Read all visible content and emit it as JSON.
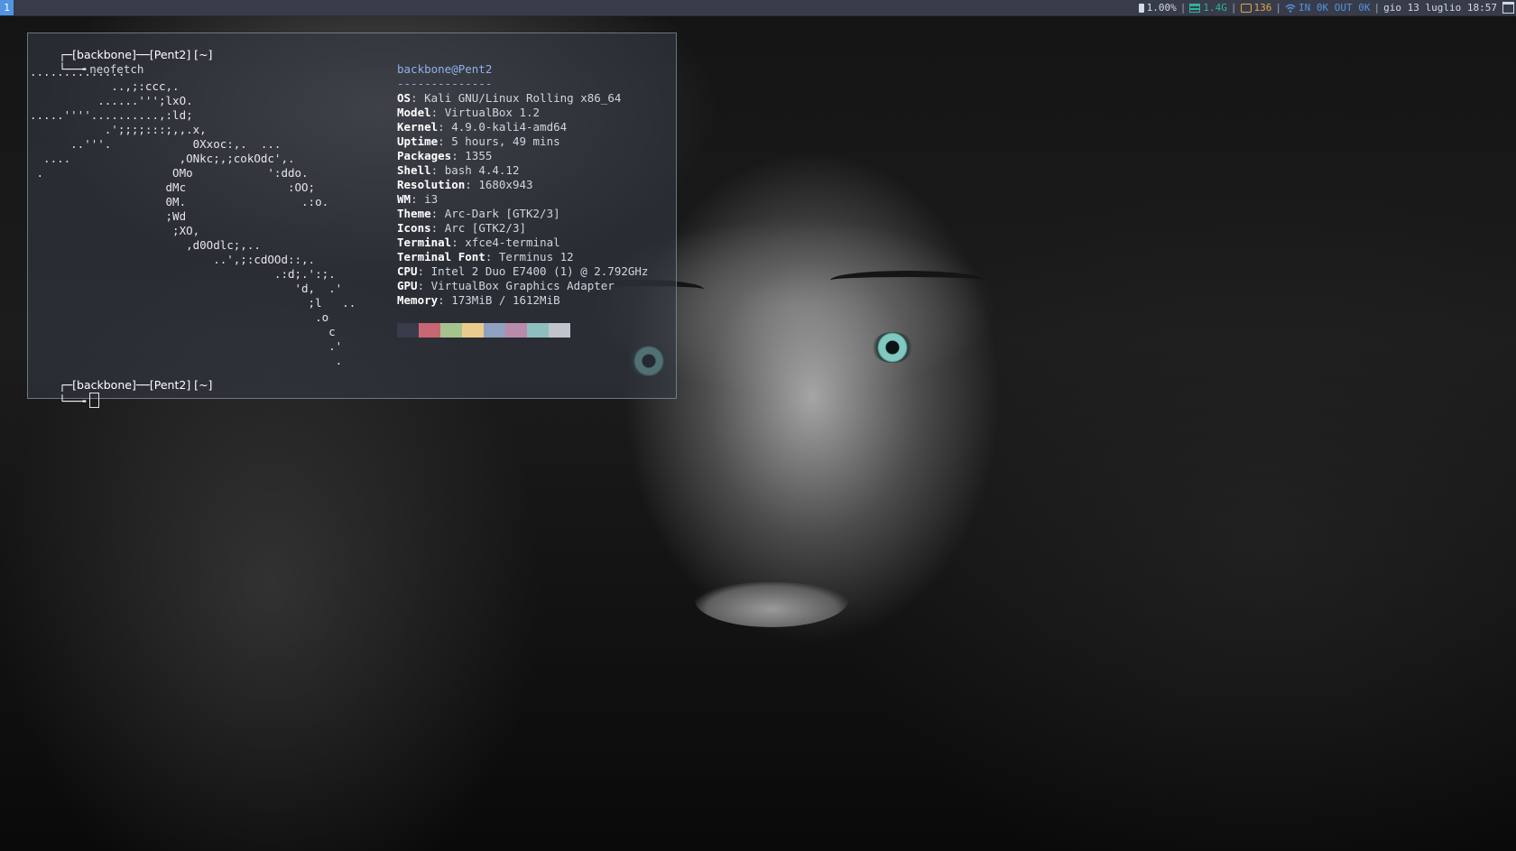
{
  "topbar": {
    "workspace": "1",
    "battery": "1.00%",
    "memory": "1.4G",
    "disk": "136",
    "network": "IN 0K OUT 0K",
    "datetime": "gio 13 luglio 18:57",
    "colors": {
      "bar_bg": "#383c4a",
      "workspace_bg": "#5294e2",
      "memory": "#2eb398",
      "disk": "#e2a544",
      "network": "#5294e2"
    }
  },
  "terminal": {
    "prompt1": {
      "user": "backbone",
      "host": "Pent2",
      "dir": "~",
      "command": "neofetch"
    },
    "prompt2": {
      "user": "backbone",
      "host": "Pent2",
      "dir": "~"
    },
    "ascii_art": "..............\n            ..,;:ccc,.\n          ......''';lxO.\n.....''''..........,:ld;\n           .';;;;:::;,,.x,\n      ..'''.            0Xxoc:,.  ...\n  ....                ,ONkc;,;cokOdc',.\n .                   OMo           ':ddo.\n                    dMc               :OO;\n                    0M.                 .:o.\n                    ;Wd\n                     ;XO,\n                       ,d0Odlc;,..\n                           ..',;:cdOOd::,.\n                                    .:d;.':;.\n                                       'd,  .'\n                                         ;l   ..\n                                          .o\n                                            c\n                                            .'\n                                             .",
    "info": {
      "title": "backbone@Pent2",
      "underline": "--------------",
      "rows": [
        {
          "key": "OS",
          "value": "Kali GNU/Linux Rolling x86_64"
        },
        {
          "key": "Model",
          "value": "VirtualBox 1.2"
        },
        {
          "key": "Kernel",
          "value": "4.9.0-kali4-amd64"
        },
        {
          "key": "Uptime",
          "value": "5 hours, 49 mins"
        },
        {
          "key": "Packages",
          "value": "1355"
        },
        {
          "key": "Shell",
          "value": "bash 4.4.12"
        },
        {
          "key": "Resolution",
          "value": "1680x943"
        },
        {
          "key": "WM",
          "value": "i3"
        },
        {
          "key": "Theme",
          "value": "Arc-Dark [GTK2/3]"
        },
        {
          "key": "Icons",
          "value": "Arc [GTK2/3]"
        },
        {
          "key": "Terminal",
          "value": "xfce4-terminal"
        },
        {
          "key": "Terminal Font",
          "value": "Terminus 12"
        },
        {
          "key": "CPU",
          "value": "Intel 2 Duo E7400 (1) @ 2.792GHz"
        },
        {
          "key": "GPU",
          "value": "VirtualBox Graphics Adapter"
        },
        {
          "key": "Memory",
          "value": "173MiB / 1612MiB"
        }
      ],
      "palette": [
        "#383c4a",
        "#c86772",
        "#a5c38d",
        "#e9cb8c",
        "#8ea1c1",
        "#b88bac",
        "#8ebfbf",
        "#c0c4cc"
      ]
    }
  }
}
